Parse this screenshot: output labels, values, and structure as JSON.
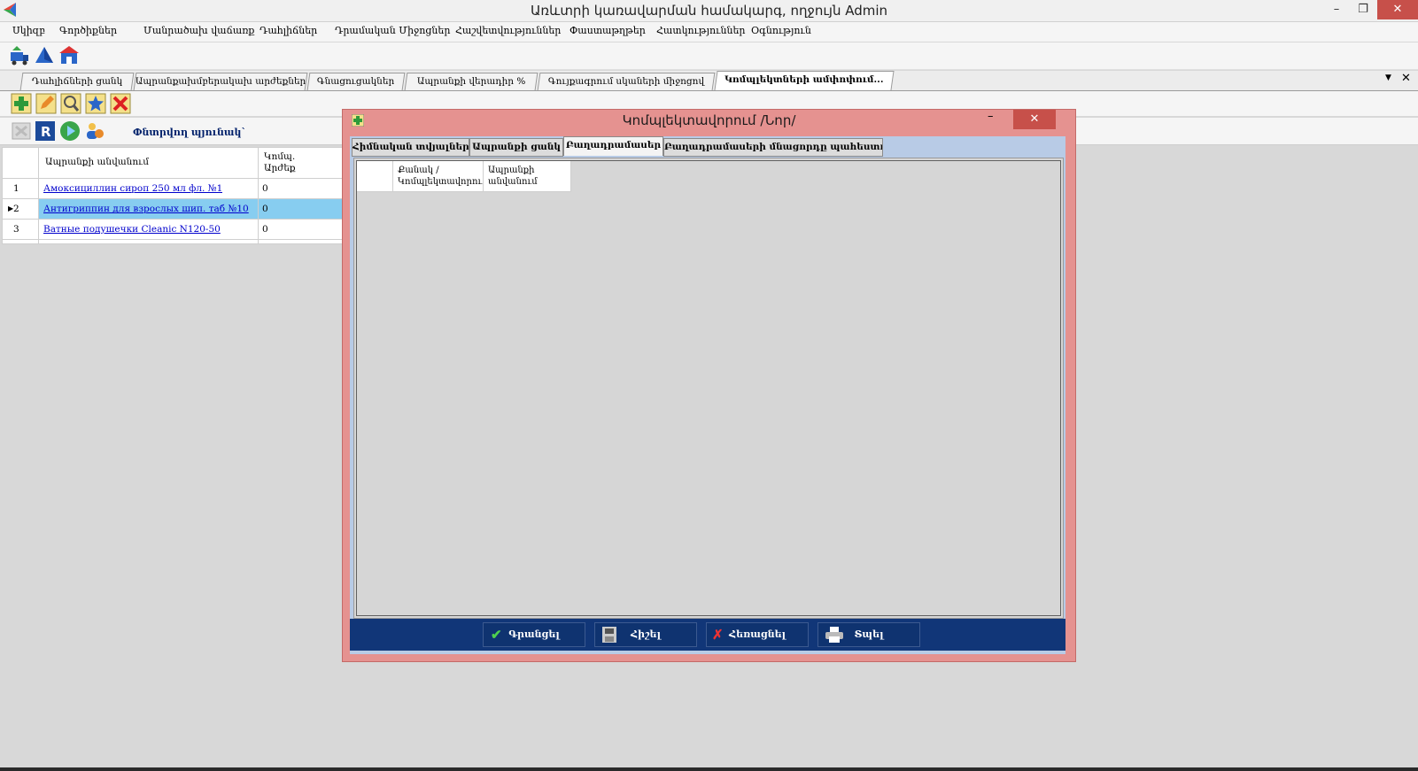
{
  "window": {
    "title": "Առևտրի կառավարման համակարգ, ողջույն Admin",
    "minimize_glyph": "–",
    "restore_glyph": "❐",
    "close_glyph": "✕"
  },
  "menu": [
    "Սկիզբ",
    "Գործիքներ",
    "Մանրածախ վաճառք",
    "Դահլիճներ",
    "Դրամական Միջոցներ",
    "Հաշվետվություններ",
    "Փաստաթղթեր",
    "Հատկություններ",
    "Օգնություն"
  ],
  "doc_tabs": [
    "Դահլիճների ցանկ",
    "Ապրանքախմբերակախ արժեքներ...",
    "Գնացուցակներ",
    "Ապրանքի վերադիր %",
    "Գույքագրում սկաների միջոցով",
    "Կոմպլեկտների ամփոփում..."
  ],
  "doc_tabs_controls": {
    "dropdown": "▼",
    "close": "✕"
  },
  "search": {
    "label": "Փնտրվող պյունակ`"
  },
  "grid": {
    "headers": [
      "Ապրանքի անվանում",
      "Կոմպ. Արժեք"
    ],
    "rows": [
      {
        "num": "1",
        "name": "Амоксициллин сироп 250 мл фл. №1",
        "value": "0"
      },
      {
        "num": "2",
        "name": "Антигриппин для взрослых шип. таб №10",
        "value": "0"
      },
      {
        "num": "3",
        "name": "Ватные подушечки Cleanic N120-50",
        "value": "0"
      }
    ]
  },
  "dialog": {
    "title": "Կոմպլեկտավորում /Նոր/",
    "minimize_glyph": "–",
    "maximize_glyph": "☐",
    "close_glyph": "✕",
    "tabs": [
      "Հիմնական տվյալներ",
      "Ապրանքի ցանկ",
      "Բաղադրամասեր",
      "Բաղադրամասերի մնացորդը պահեստում"
    ],
    "active_tab": 2,
    "inner_grid_headers": [
      "Քանակ /Կոմպլեկտավորու",
      "Ապրանքի անվանում"
    ],
    "buttons": {
      "save": "Գրանցել",
      "print": "Հիշել",
      "cancel": "Հեռացնել",
      "exit": "Տպել"
    }
  },
  "colors": {
    "dialog_bg": "#e59290",
    "footer_bg": "#113678",
    "selection": "#87cdf0",
    "close_red": "#c7504a"
  }
}
